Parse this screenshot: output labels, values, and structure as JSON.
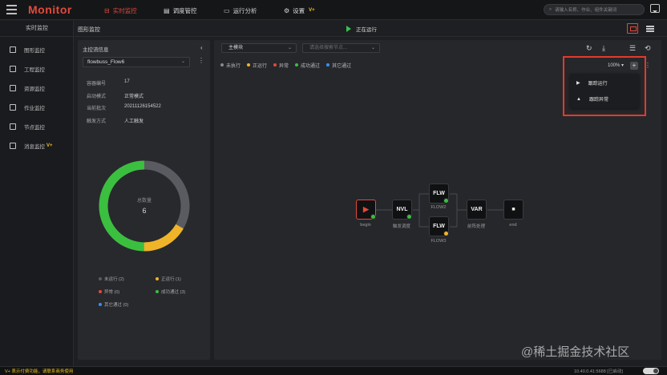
{
  "app": {
    "title": "Monitor"
  },
  "topnav": [
    {
      "label": "实时监控",
      "icon": "monitor-icon"
    },
    {
      "label": "调度管控",
      "icon": "schedule-icon"
    },
    {
      "label": "运行分析",
      "icon": "analysis-icon"
    },
    {
      "label": "设置",
      "icon": "gear-icon",
      "badge": "V+"
    }
  ],
  "search": {
    "placeholder": "请输入名称、作业、组件关键词"
  },
  "sidebar": {
    "title": "实时监控",
    "items": [
      {
        "label": "图形监控"
      },
      {
        "label": "工程监控"
      },
      {
        "label": "资源监控"
      },
      {
        "label": "作业监控"
      },
      {
        "label": "节点监控"
      },
      {
        "label": "消息监控",
        "badge": "V+"
      }
    ]
  },
  "header": {
    "title": "图形监控",
    "status": "正在运行"
  },
  "left_panel": {
    "title": "主控流信息",
    "flow_select": "flowbuss_Flow6",
    "fields": [
      {
        "key": "容器编号",
        "value": "17"
      },
      {
        "key": "启动模式",
        "value": "正常模式"
      },
      {
        "key": "当前批次",
        "value": "20211126154522"
      },
      {
        "key": "触发方式",
        "value": "人工触发"
      }
    ],
    "donut": {
      "label": "总数量",
      "value": "6"
    },
    "legend": [
      {
        "label": "未运行 (2)",
        "color": "#5a5b60"
      },
      {
        "label": "正运行 (1)",
        "color": "#f0b429"
      },
      {
        "label": "异常 (0)",
        "color": "#e24a3b"
      },
      {
        "label": "成功通过 (3)",
        "color": "#3bbf3f"
      },
      {
        "label": "其它通过 (0)",
        "color": "#3a8ff0"
      }
    ]
  },
  "canvas": {
    "module_select": "主模块",
    "node_search_placeholder": "请选择搜索节点...",
    "status_legend": [
      {
        "label": "未执行",
        "color": "#8a8a8a"
      },
      {
        "label": "正运行",
        "color": "#f0b429"
      },
      {
        "label": "异常",
        "color": "#e24a3b"
      },
      {
        "label": "成功通过",
        "color": "#3bbf3f"
      },
      {
        "label": "其它通过",
        "color": "#3a8ff0"
      }
    ],
    "zoom": "100% ▾",
    "dropdown": [
      {
        "label": "跟踪运行",
        "icon": "play-icon"
      },
      {
        "label": "跟踪异常",
        "icon": "warning-icon"
      }
    ],
    "nodes": [
      {
        "id": "begin",
        "text": "▶",
        "label": "begin",
        "status": "success"
      },
      {
        "id": "nvl",
        "text": "NVL",
        "label": "触发调度",
        "status": "success"
      },
      {
        "id": "flw2",
        "text": "FLW",
        "label": "FLOW2",
        "status": "success"
      },
      {
        "id": "flw3",
        "text": "FLW",
        "label": "FLOW3",
        "status": "running"
      },
      {
        "id": "var",
        "text": "VAR",
        "label": "前阵处理",
        "status": "none"
      },
      {
        "id": "end",
        "text": "■",
        "label": "end",
        "status": "none"
      }
    ]
  },
  "footer": {
    "notice": "V+ 表示付费功能，请联系商务使用",
    "right": "10.40.0.41:5688 [已启动]"
  },
  "watermark": "@稀土掘金技术社区",
  "colors": {
    "accent": "#e24a3b",
    "success": "#3bbf3f",
    "running": "#f0b429",
    "idle": "#5a5b60"
  }
}
